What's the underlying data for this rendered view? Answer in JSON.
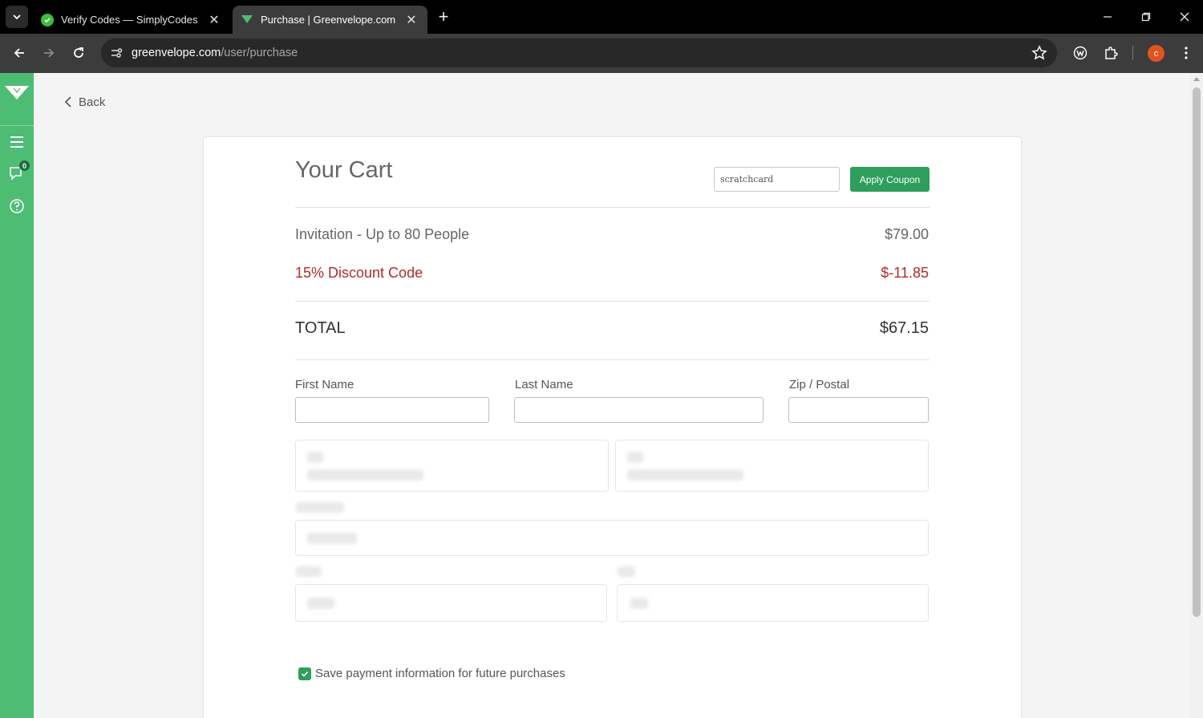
{
  "browser": {
    "tabs": [
      {
        "title": "Verify Codes — SimplyCodes",
        "active": false,
        "favicon_color": "#3cbf3c"
      },
      {
        "title": "Purchase | Greenvelope.com",
        "active": true,
        "favicon_color": "#4dbd74"
      }
    ],
    "url_host": "greenvelope.com",
    "url_path": "/user/purchase",
    "profile_initial": "c"
  },
  "sidebar": {
    "notification_count": "0",
    "icons": [
      "menu-icon",
      "chat-icon",
      "help-icon"
    ]
  },
  "page": {
    "back_label": "Back",
    "cart_title": "Your Cart",
    "coupon_value": "scratchcard",
    "apply_coupon_label": "Apply Coupon",
    "items": [
      {
        "label": "Invitation - Up to 80 People",
        "amount": "$79.00"
      },
      {
        "label": "15% Discount Code",
        "amount": "$-11.85"
      }
    ],
    "total_label": "TOTAL",
    "total_amount": "$67.15",
    "fields": {
      "first_name": "First Name",
      "last_name": "Last Name",
      "zip": "Zip / Postal"
    },
    "save_payment_label": "Save payment information for future purchases",
    "save_payment_checked": true
  },
  "colors": {
    "brand_green": "#4dbd74",
    "button_green": "#2e9e5c",
    "discount_red": "#b22b2b"
  }
}
